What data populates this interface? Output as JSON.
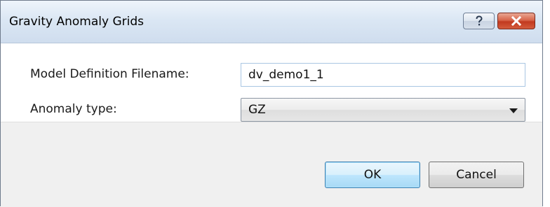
{
  "window": {
    "title": "Gravity Anomaly Grids",
    "help_icon": "question-mark-icon",
    "close_icon": "close-x-icon"
  },
  "form": {
    "model_label": "Model Definition Filename:",
    "model_value": "dv_demo1_1",
    "anomaly_label": "Anomaly type:",
    "anomaly_selected": "GZ"
  },
  "buttons": {
    "ok_label": "OK",
    "cancel_label": "Cancel"
  },
  "colors": {
    "close_button": "#c23a20",
    "ok_button_border": "#3c7fb1",
    "titlebar": "#dbe7f4"
  }
}
